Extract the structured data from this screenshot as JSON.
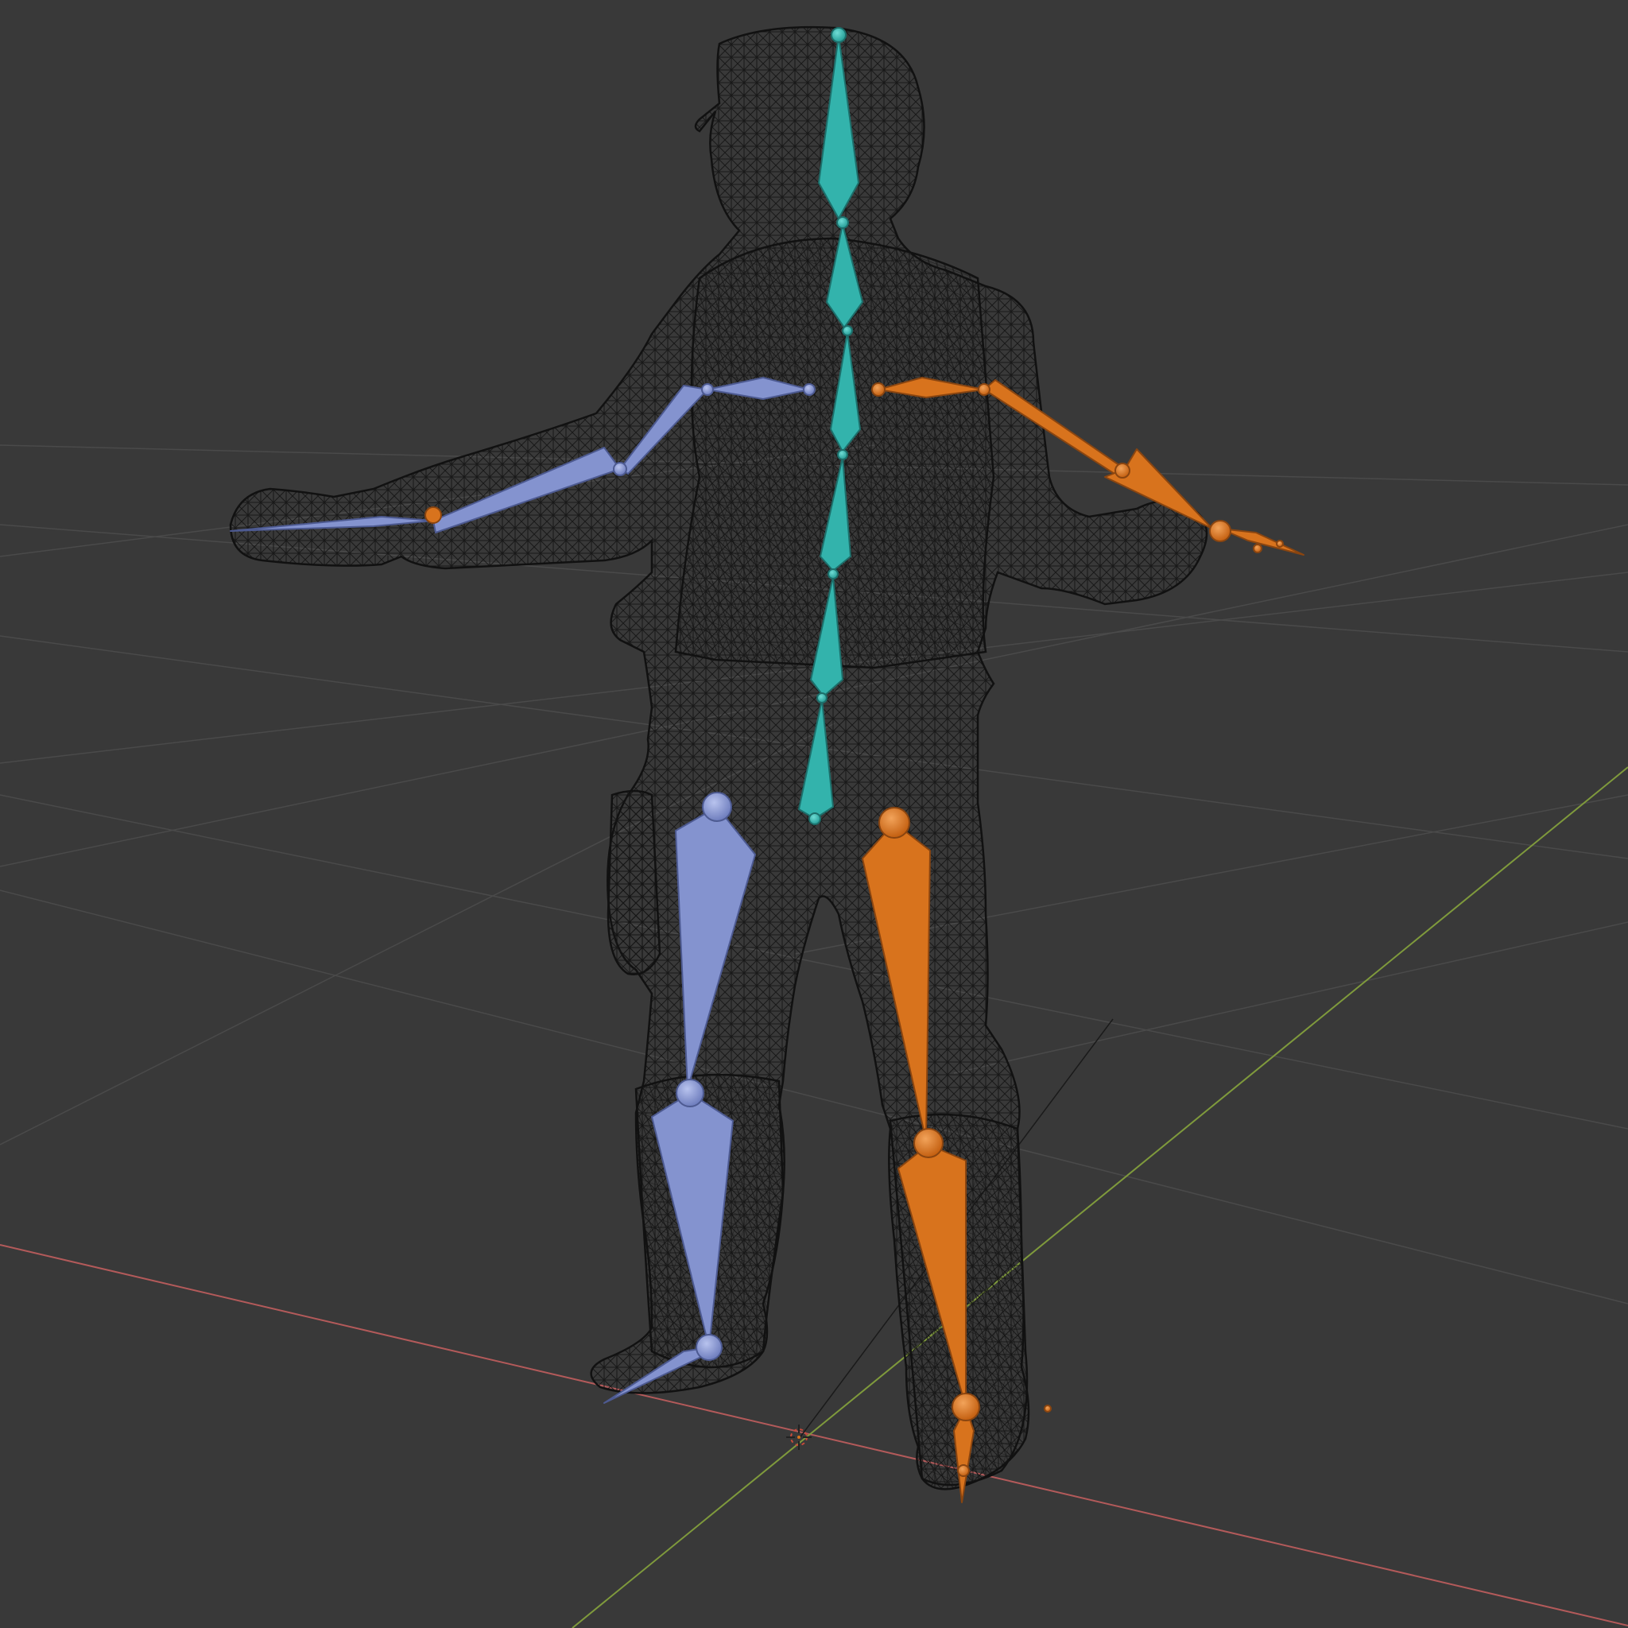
{
  "viewport": {
    "name": "3D Viewport",
    "shading": "wireframe",
    "background_color": "#393939",
    "grid_color": "#4a4a4a",
    "x_axis_color": "#b35a5a",
    "y_axis_color": "#7f9a3c"
  },
  "mesh": {
    "name": "character-mesh",
    "wire_color": "#111111"
  },
  "armature": {
    "name": "armature",
    "colors": {
      "spine": "#33b3ac",
      "left_side": "#8493cf",
      "right_side": "#d8731d"
    },
    "bones": [
      {
        "name": "head",
        "group": "spine"
      },
      {
        "name": "neck",
        "group": "spine"
      },
      {
        "name": "spine-upper",
        "group": "spine"
      },
      {
        "name": "spine-mid",
        "group": "spine"
      },
      {
        "name": "spine-lower",
        "group": "spine"
      },
      {
        "name": "hips",
        "group": "spine"
      },
      {
        "name": "shoulder-l",
        "group": "left_side"
      },
      {
        "name": "upper-arm-l",
        "group": "left_side"
      },
      {
        "name": "forearm-l",
        "group": "left_side"
      },
      {
        "name": "hand-l",
        "group": "left_side"
      },
      {
        "name": "thigh-l",
        "group": "left_side"
      },
      {
        "name": "shin-l",
        "group": "left_side"
      },
      {
        "name": "foot-l",
        "group": "left_side"
      },
      {
        "name": "shoulder-r",
        "group": "right_side"
      },
      {
        "name": "upper-arm-r",
        "group": "right_side"
      },
      {
        "name": "forearm-r",
        "group": "right_side"
      },
      {
        "name": "hand-r",
        "group": "right_side"
      },
      {
        "name": "thigh-r",
        "group": "right_side"
      },
      {
        "name": "shin-r",
        "group": "right_side"
      },
      {
        "name": "foot-r",
        "group": "right_side"
      }
    ]
  },
  "cursor": {
    "name": "3d-cursor-icon"
  }
}
